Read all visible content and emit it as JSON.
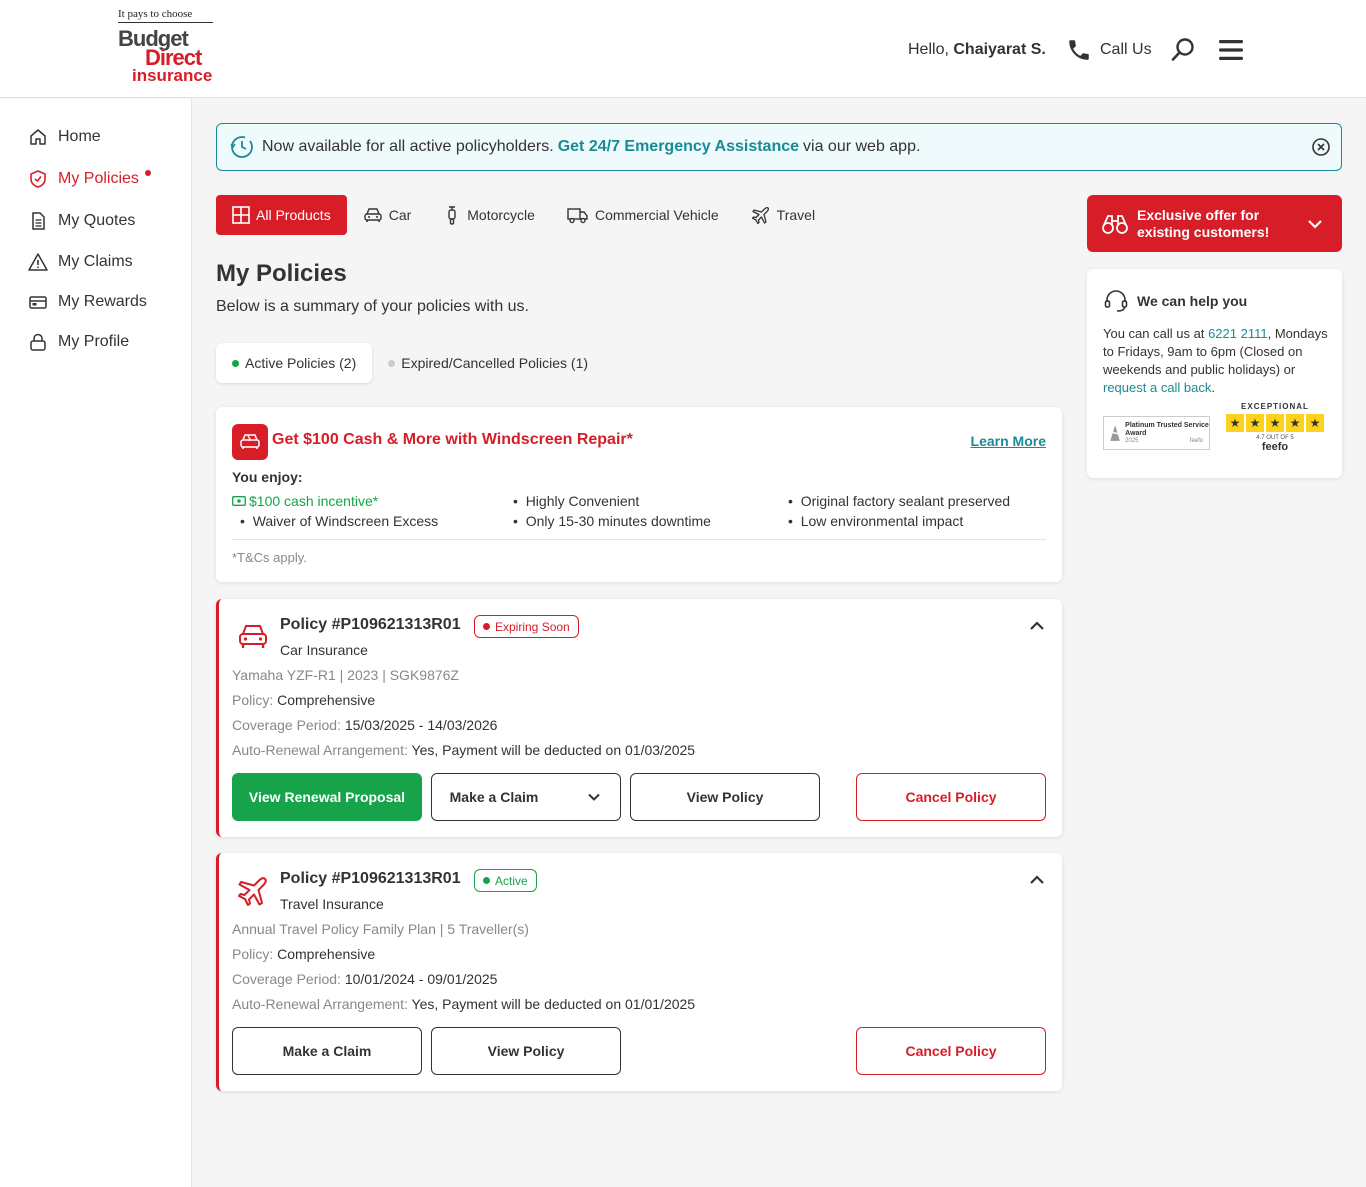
{
  "header": {
    "tagline": "It pays to choose",
    "logo_line1": "Budget",
    "logo_line2": "Direct",
    "logo_line3": "insurance",
    "greeting": "Hello,",
    "user_name": "Chaiyarat S.",
    "call_label": "Call Us"
  },
  "sidebar": {
    "items": [
      {
        "label": "Home",
        "icon": "home-icon"
      },
      {
        "label": "My Policies",
        "icon": "shield-icon",
        "active": true
      },
      {
        "label": "My Quotes",
        "icon": "document-icon"
      },
      {
        "label": "My Claims",
        "icon": "warning-icon"
      },
      {
        "label": "My Rewards",
        "icon": "card-icon"
      },
      {
        "label": "My Profile",
        "icon": "lock-icon"
      }
    ]
  },
  "banner": {
    "text_before": "Now available for all active policyholders.",
    "link_text": "Get 24/7 Emergency Assistance",
    "text_after": "via our web app."
  },
  "product_tabs": [
    {
      "label": "All Products",
      "active": true
    },
    {
      "label": "Car"
    },
    {
      "label": "Motorcycle"
    },
    {
      "label": "Commercial Vehicle"
    },
    {
      "label": "Travel"
    }
  ],
  "main": {
    "title": "My Policies",
    "subtitle": "Below is a summary of your policies with us.",
    "policy_tabs": [
      {
        "label": "Active Policies (2)",
        "active": true,
        "dot_color": "#16a34a"
      },
      {
        "label": "Expired/Cancelled Policies (1)",
        "dot_color": "#cccccc"
      }
    ]
  },
  "promo": {
    "title": "Get $100 Cash & More with Windscreen Repair*",
    "learn_more": "Learn More",
    "enjoy": "You enjoy:",
    "benefits": [
      "$100 cash incentive*",
      "Waiver of Windscreen Excess",
      "Highly Convenient",
      "Only 15-30 minutes downtime",
      "Original factory sealant preserved",
      "Low environmental impact"
    ],
    "tnc": "*T&Cs apply."
  },
  "policies": [
    {
      "number": "Policy #P109621313R01",
      "status": "Expiring Soon",
      "type": "Car Insurance",
      "details": "Yamaha YZF-R1 | 2023 | SGK9876Z",
      "policy_label": "Policy:",
      "policy_value": "Comprehensive",
      "coverage_label": "Coverage Period:",
      "coverage_value": "15/03/2025 - 14/03/2026",
      "renewal_label": "Auto-Renewal Arrangement:",
      "renewal_value": "Yes, Payment will be deducted on 01/03/2025",
      "btn_renewal": "View Renewal Proposal",
      "btn_claim": "Make a Claim",
      "btn_view": "View Policy",
      "btn_cancel": "Cancel Policy"
    },
    {
      "number": "Policy #P109621313R01",
      "status": "Active",
      "type": "Travel Insurance",
      "details": "Annual Travel Policy Family Plan | 5 Traveller(s)",
      "policy_label": "Policy:",
      "policy_value": "Comprehensive",
      "coverage_label": "Coverage Period:",
      "coverage_value": "10/01/2024 - 09/01/2025",
      "renewal_label": "Auto-Renewal Arrangement:",
      "renewal_value": "Yes, Payment will be deducted on 01/01/2025",
      "btn_claim": "Make a Claim",
      "btn_view": "View Policy",
      "btn_cancel": "Cancel Policy"
    }
  ],
  "offer": {
    "text": "Exclusive offer for existing customers!"
  },
  "help": {
    "title": "We can help you",
    "text1": "You can call us at",
    "phone": "6221 2111",
    "text2": ", Mondays to Fridays, 9am to 6pm (Closed on weekends and public holidays) or",
    "callback": "request a call back",
    "text3": ".",
    "award_text": "Platinum Trusted Service Award",
    "award_year": "2025",
    "award_brand": "feefo",
    "feefo_rating_label": "EXCEPTIONAL",
    "feefo_score": "4.7 OUT OF 5",
    "feefo_brand": "feefo"
  },
  "colors": {
    "brand_red": "#d71e28",
    "teal": "#1a8b96",
    "green": "#16a34a"
  }
}
